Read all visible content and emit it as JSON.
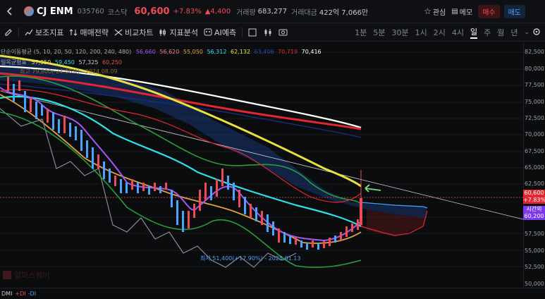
{
  "header": {
    "name": "CJ ENM",
    "code": "035760",
    "market": "코스닥",
    "price": "60,600",
    "change_pct": "+7.83%",
    "change_abs": "▲4,400",
    "volume_label": "거래량",
    "volume": "683,277",
    "amount_label": "거래대금",
    "amount": "422억 7,066만",
    "watch_label": "관심",
    "memo_label": "메모",
    "buy_label": "매수",
    "sell_label": "매도"
  },
  "toolbar": {
    "indicator_label": "보조지표",
    "strategy_label": "매매전략",
    "compare_label": "비교차트",
    "analysis_label": "지표분석",
    "ai_label": "AI예측",
    "periods": [
      "1분",
      "5분",
      "30분",
      "1시",
      "2시",
      "4시",
      "일",
      "주",
      "월",
      "년"
    ],
    "active_period": "일"
  },
  "legend": {
    "ma_title": "단순이동평균 (5, 10, 20, 50, 120, 200, 240, 480)",
    "ma_values": [
      "56,660",
      "56,620",
      "55,050",
      "56,312",
      "62,132",
      "63,406",
      "70,719",
      "70,416"
    ],
    "ichimoku_title": "일목균형표",
    "ichimoku_values": [
      "57,950",
      "59,450",
      "57,325",
      "60,250"
    ],
    "third_line": "최고 79,800(-24.06%) - 2024.08.09"
  },
  "yaxis": {
    "labels": [
      "82,500",
      "80,000",
      "77,500",
      "75,000",
      "72,500",
      "70,000",
      "67,500",
      "65,000",
      "62,500",
      "57,500",
      "55,000",
      "52,500",
      "50,000"
    ]
  },
  "price_badge": {
    "price": "60,600",
    "pct": "+7.83%",
    "label": "시간외",
    "after_price": "60,200"
  },
  "annotation": {
    "low": "최저 51,400(+17.90%) - 2025.01.13"
  },
  "watermark": {
    "text": "알파스퀘어"
  },
  "footer": {
    "dmi": "DMI",
    "plus_di": "+DI",
    "minus_di": "-DI"
  },
  "colors": {
    "up": "#ef4a55",
    "down": "#4aa3ff",
    "accent": "#e6e040"
  }
}
